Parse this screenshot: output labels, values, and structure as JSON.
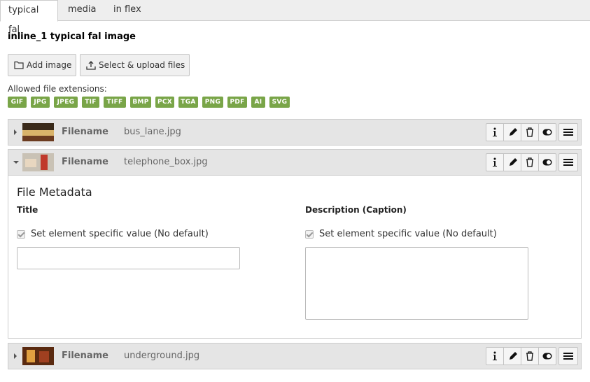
{
  "tabs": [
    {
      "label": "typical fal",
      "active": true
    },
    {
      "label": "media",
      "active": false
    },
    {
      "label": "in flex",
      "active": false
    }
  ],
  "field": {
    "title": "inline_1 typical fal image",
    "add_image_label": "Add image",
    "select_upload_label": "Select & upload files",
    "allowed_label": "Allowed file extensions:",
    "extensions": [
      "GIF",
      "JPG",
      "JPEG",
      "TIF",
      "TIFF",
      "BMP",
      "PCX",
      "TGA",
      "PNG",
      "PDF",
      "AI",
      "SVG"
    ]
  },
  "files": [
    {
      "label": "Filename",
      "name": "bus_lane.jpg",
      "expanded": false,
      "thumb_colors": [
        "#3a2a1a",
        "#d9b36a",
        "#6b3b20"
      ]
    },
    {
      "label": "Filename",
      "name": "telephone_box.jpg",
      "expanded": true,
      "thumb_colors": [
        "#c9c2b5",
        "#c0392b",
        "#e8d7c0"
      ]
    },
    {
      "label": "Filename",
      "name": "underground.jpg",
      "expanded": false,
      "thumb_colors": [
        "#5a2a10",
        "#e0a040",
        "#a04020"
      ]
    }
  ],
  "metadata": {
    "heading": "File Metadata",
    "title_label": "Title",
    "description_label": "Description (Caption)",
    "override_label": "Set element specific value (No default)",
    "title_value": "",
    "description_value": ""
  },
  "colors": {
    "badge": "#79a548",
    "header_bg": "#e5e5e5",
    "tab_bg": "#eeeeee"
  }
}
